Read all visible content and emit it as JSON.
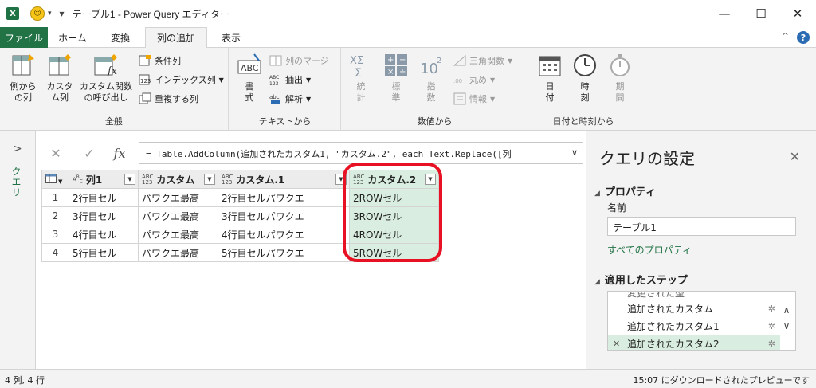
{
  "window": {
    "app_icon": "X",
    "title": "テーブル1 - Power Query エディター",
    "min": "—",
    "max": "☐",
    "close": "✕"
  },
  "tabs": [
    "ファイル",
    "ホーム",
    "変換",
    "列の追加",
    "表示"
  ],
  "active_tab": "列の追加",
  "ribbon": {
    "general": {
      "label": "全般",
      "col_from_examples": "例から\nの列",
      "custom_col": "カスタ\nム列",
      "invoke_custom_fn": "カスタム関数\nの呼び出し",
      "conditional_col": "条件列",
      "index_col": "インデックス列",
      "duplicate_col": "重複する列"
    },
    "text": {
      "label": "テキストから",
      "format": "書\n式",
      "merge_cols": "列のマージ",
      "extract": "抽出",
      "parse": "解析"
    },
    "number": {
      "label": "数値から",
      "statistics": "統\n計",
      "standard": "標\n準",
      "scientific": "指\n数",
      "trig": "三角関数",
      "rounding": "丸め",
      "information": "情報"
    },
    "datetime": {
      "label": "日付と時刻から",
      "date": "日\n付",
      "time": "時\n刻",
      "duration": "期\n間"
    }
  },
  "formula": {
    "cancel": "✕",
    "confirm": "✓",
    "fx": "fx",
    "text": "= Table.AddColumn(追加されたカスタム1, \"カスタム.2\", each Text.Replace([列",
    "expand": "∨"
  },
  "queries_pane": {
    "label": "クエリ",
    "chevron": ">"
  },
  "grid": {
    "headers": [
      {
        "type": "ABC",
        "name": "列1"
      },
      {
        "type": "ABC\n123",
        "name": "カスタム"
      },
      {
        "type": "ABC\n123",
        "name": "カスタム.1"
      },
      {
        "type": "ABC\n123",
        "name": "カスタム.2"
      }
    ],
    "rows": [
      {
        "n": "1",
        "c1": "2行目セル",
        "c2": "パワクエ最高",
        "c3": "2行目セルパワクエ",
        "c4": "2ROWセル"
      },
      {
        "n": "2",
        "c1": "3行目セル",
        "c2": "パワクエ最高",
        "c3": "3行目セルパワクエ",
        "c4": "3ROWセル"
      },
      {
        "n": "3",
        "c1": "4行目セル",
        "c2": "パワクエ最高",
        "c3": "4行目セルパワクエ",
        "c4": "4ROWセル"
      },
      {
        "n": "4",
        "c1": "5行目セル",
        "c2": "パワクエ最高",
        "c3": "5行目セルパワクエ",
        "c4": "5ROWセル"
      }
    ]
  },
  "settings": {
    "title": "クエリの設定",
    "properties": "プロパティ",
    "name_label": "名前",
    "name_value": "テーブル1",
    "all_props": "すべてのプロパティ",
    "applied_steps": "適用したステップ",
    "steps": [
      "変更された型",
      "追加されたカスタム",
      "追加されたカスタム1",
      "追加されたカスタム2"
    ]
  },
  "status": {
    "left": "4 列, 4 行",
    "right": "15:07 にダウンロードされたプレビューです"
  },
  "colors": {
    "accent": "#217346",
    "highlight": "#d9eee0",
    "ring": "#e81123"
  }
}
